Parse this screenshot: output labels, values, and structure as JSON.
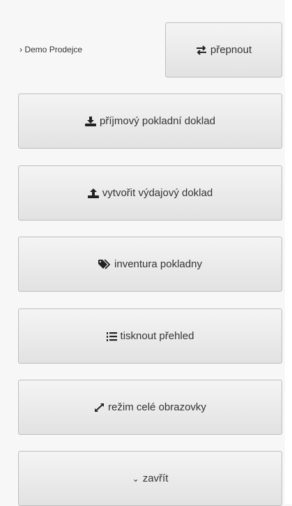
{
  "header": {
    "user_prefix": "›",
    "user_name": "Demo Prodejce",
    "switch_label": "přepnout"
  },
  "actions": {
    "income_label": "příjmový pokladní doklad",
    "expense_label": "vytvořit výdajový doklad",
    "inventory_label": "inventura pokladny",
    "print_label": "tisknout přehled",
    "fullscreen_label": "režim celé obrazovky",
    "close_prefix": "⌄",
    "close_label": "zavřít"
  },
  "icons": {
    "switch": "arrows-exchange-icon",
    "income": "download-icon",
    "expense": "upload-icon",
    "inventory": "tags-icon",
    "print": "list-ordered-icon",
    "fullscreen": "expand-arrows-icon",
    "close": "chevron-down-icon"
  }
}
